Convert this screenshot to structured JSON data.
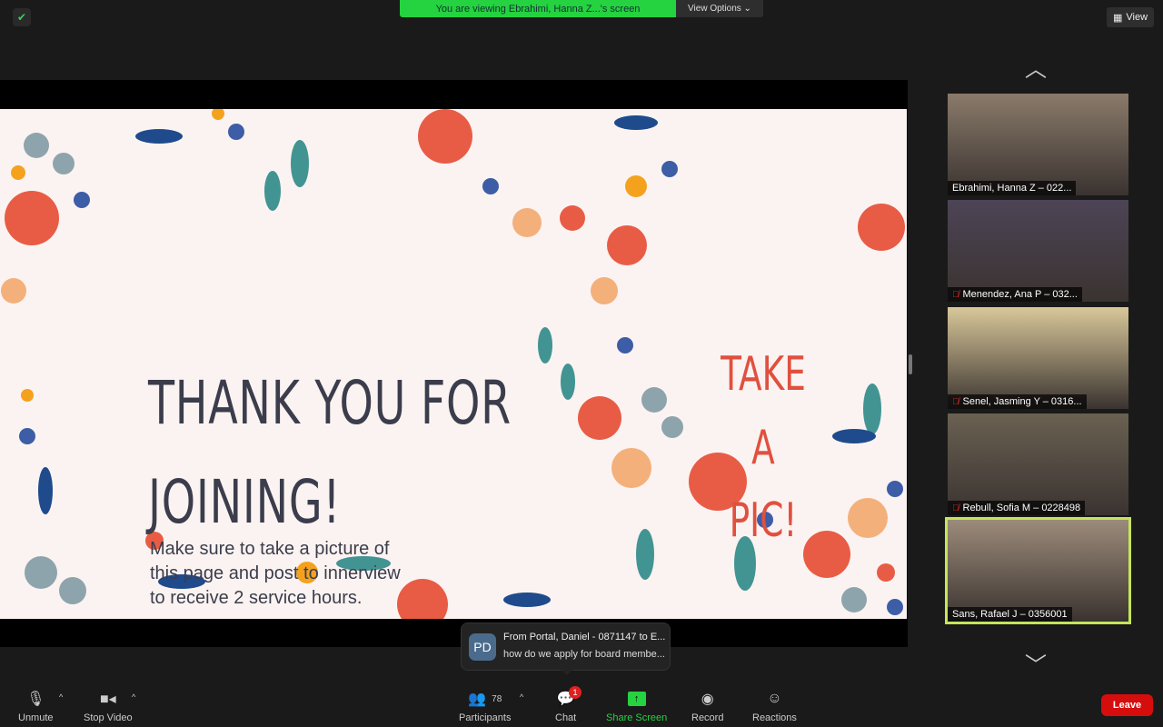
{
  "top": {
    "banner": "You are viewing Ebrahimi, Hanna Z...'s screen",
    "view_options": "View Options ⌄",
    "view": "View"
  },
  "slide": {
    "title_line1": "THANK YOU FOR",
    "title_line2": "JOINING!",
    "body": "Make sure to take a picture of this page and post to innerview to receive 2 service hours.",
    "side_line1": "TAKE A",
    "side_line2": "PIC!"
  },
  "participants": [
    {
      "name": "Ebrahimi, Hanna Z – 022...",
      "muted": false,
      "bg": "#8a7a6a"
    },
    {
      "name": "Menendez, Ana P – 032...",
      "muted": true,
      "bg": "#4d4456"
    },
    {
      "name": "Senel, Jasming Y – 0316...",
      "muted": true,
      "bg": "#d9c89a"
    },
    {
      "name": "Rebull, Sofia M – 0228498",
      "muted": true,
      "bg": "#6a6152"
    },
    {
      "name": "Sans, Rafael J – 0356001",
      "muted": false,
      "bg": "#9c8b7a"
    }
  ],
  "toolbar": {
    "unmute": "Unmute",
    "stop_video": "Stop Video",
    "participants": "Participants",
    "participant_count": "78",
    "chat": "Chat",
    "chat_badge": "1",
    "share": "Share Screen",
    "record": "Record",
    "reactions": "Reactions",
    "leave": "Leave"
  },
  "toast": {
    "initials": "PD",
    "line1": "From Portal, Daniel - 0871147 to E...",
    "line2": "how do we apply for board membe..."
  },
  "colors": {
    "share_green": "#25d23f",
    "leave_red": "#d60d0d",
    "active_border": "#c4e55a"
  }
}
